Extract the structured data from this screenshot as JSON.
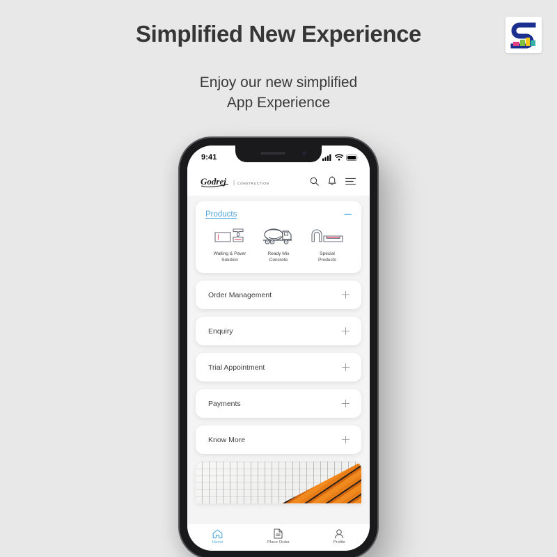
{
  "page": {
    "title": "Simplified New Experience",
    "subtitle": "Enjoy our new simplified\nApp Experience",
    "background_color": "#e8e8e8",
    "title_color": "#363636"
  },
  "brand_logo": {
    "name": "s-blocks-logo",
    "primary_color": "#1b2f8f",
    "block_colors": [
      "#e0417f",
      "#f5c518",
      "#35b0a8",
      "#7fc242"
    ]
  },
  "phone": {
    "status_bar": {
      "time": "9:41",
      "icons": [
        "cellular-signal-icon",
        "wifi-icon",
        "battery-icon"
      ]
    },
    "app_header": {
      "brand": "Godrej",
      "brand_sub": "CONSTRUCTION",
      "actions": [
        {
          "name": "search-icon",
          "label": "Search"
        },
        {
          "name": "notification-bell-icon",
          "label": "Notifications"
        },
        {
          "name": "hamburger-menu-icon",
          "label": "Menu"
        }
      ]
    },
    "products_card": {
      "title": "Products",
      "title_color": "#4ea8dd",
      "toggle_icon": "minus-icon",
      "expanded": true,
      "items": [
        {
          "label": "Walling & Paver\nSolution",
          "icon": "block-paver-icon"
        },
        {
          "label": "Ready Mix\nConcrete",
          "icon": "cement-mixer-truck-icon"
        },
        {
          "label": "Special\nProducts",
          "icon": "arch-lintel-icon"
        }
      ]
    },
    "accordion_items": [
      {
        "label": "Order Management",
        "toggle_icon": "plus-icon"
      },
      {
        "label": "Enquiry",
        "toggle_icon": "plus-icon"
      },
      {
        "label": "Trial Appointment",
        "toggle_icon": "plus-icon"
      },
      {
        "label": "Payments",
        "toggle_icon": "plus-icon"
      },
      {
        "label": "Know More",
        "toggle_icon": "plus-icon"
      }
    ],
    "promo_banner": {
      "name": "paver-and-pipes-banner",
      "paver_color": "#d2d1ce",
      "stripe_color": "#ef8519"
    },
    "bottom_nav": {
      "active": "Home",
      "active_color": "#4ea8dd",
      "items": [
        {
          "label": "Home",
          "icon": "home-icon",
          "active": true
        },
        {
          "label": "Place Order",
          "icon": "document-icon",
          "active": false
        },
        {
          "label": "Profile",
          "icon": "person-icon",
          "active": false
        }
      ]
    }
  }
}
